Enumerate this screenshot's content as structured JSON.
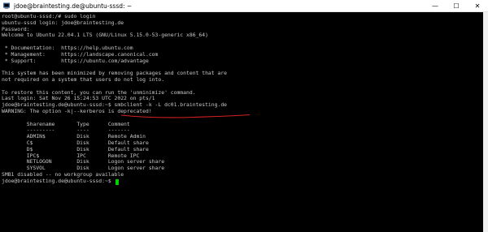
{
  "window": {
    "title": "jdoe@braintesting.de@ubuntu-sssd: ~",
    "icon": "putty-terminal-icon",
    "controls": {
      "minimize": "—",
      "maximize": "☐",
      "close": "✕"
    }
  },
  "terminal": {
    "lines": [
      "root@ubuntu-sssd:/# sudo login",
      "ubuntu-sssd login: jdoe@braintesting.de",
      "Password:",
      "Welcome to Ubuntu 22.04.1 LTS (GNU/Linux 5.15.0-53-generic x86_64)",
      "",
      " * Documentation:  https://help.ubuntu.com",
      " * Management:     https://landscape.canonical.com",
      " * Support:        https://ubuntu.com/advantage",
      "",
      "This system has been minimized by removing packages and content that are",
      "not required on a system that users do not log into.",
      "",
      "To restore this content, you can run the 'unminimize' command.",
      "Last login: Sat Nov 26 15:24:53 UTC 2022 on pts/1",
      "jdoe@braintesting.de@ubuntu-sssd:~$ smbclient -k -L dc01.braintesting.de",
      "WARNING: The option -k|--kerberos is deprecated!",
      "",
      "        Sharename       Type      Comment",
      "        ---------       ----      -------",
      "        ADMIN$          Disk      Remote Admin",
      "        C$              Disk      Default share",
      "        D$              Disk      Default share",
      "        IPC$            IPC       Remote IPC",
      "        NETLOGON        Disk      Logon server share",
      "        SYSVOL          Disk      Logon server share",
      "SMB1 disabled -- no workgroup available"
    ],
    "prompt": "jdoe@braintesting.de@ubuntu-sssd:~$ ",
    "cursor_color": "#00d000",
    "underline_color": "#d42020"
  }
}
